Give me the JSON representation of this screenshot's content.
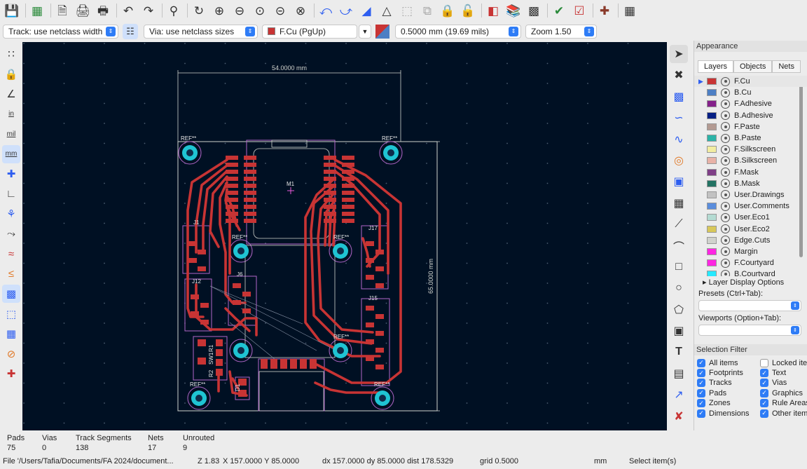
{
  "toolbar": {
    "buttons": [
      "save-icon",
      "board-setup-icon",
      "new-page-icon",
      "print-icon",
      "plot-icon",
      "undo-icon",
      "redo-icon",
      "find-icon",
      "refresh-icon",
      "zoom-in-icon",
      "zoom-out-icon",
      "zoom-fit-icon",
      "zoom-objects-icon",
      "zoom-selection-icon",
      "flip-icon",
      "rotate-ccw-icon",
      "rotate-cw-icon",
      "mirror-h-icon",
      "mirror-v-icon",
      "group-icon",
      "ungroup-icon",
      "lock-icon",
      "unlock-icon",
      "netlist-icon",
      "footprint-browser-icon",
      "footprint-editor-icon",
      "drc-icon",
      "scripting-icon",
      "bom-icon",
      "console-icon"
    ]
  },
  "aux_toolbar": {
    "track_width": "Track: use netclass width",
    "via_size": "Via: use netclass sizes",
    "active_layer": "F.Cu (PgUp)",
    "grid": "0.5000 mm (19.69 mils)",
    "zoom": "Zoom 1.50"
  },
  "left_toolbar": {
    "units": {
      "inch": "in",
      "mil": "mil",
      "mm": "mm"
    }
  },
  "canvas": {
    "width_dimension": "54.0000 mm",
    "height_dimension": "65.0000 mm",
    "labels": {
      "ref_tl": "REF**",
      "ref_tr": "REF**",
      "ref_ml": "REF**",
      "ref_mr": "REF**",
      "ref_bl": "REF**",
      "ref_br": "REF**",
      "ref_bm": "REF**",
      "ref_bml": "REF**",
      "m1": "M1",
      "j1": "J1",
      "j6": "J6",
      "j12": "J12",
      "j15": "J15",
      "j17": "J17",
      "r2": "R2",
      "sw1": "SW1",
      "r1": "R1",
      "d1": "D1"
    }
  },
  "appearance": {
    "title": "Appearance",
    "tabs": [
      "Layers",
      "Objects",
      "Nets"
    ],
    "layers": [
      {
        "name": "F.Cu",
        "color": "#c83434"
      },
      {
        "name": "B.Cu",
        "color": "#4d7fc4"
      },
      {
        "name": "F.Adhesive",
        "color": "#84218a"
      },
      {
        "name": "B.Adhesive",
        "color": "#051f84"
      },
      {
        "name": "F.Paste",
        "color": "#b39a92"
      },
      {
        "name": "B.Paste",
        "color": "#2bb3a7"
      },
      {
        "name": "F.Silkscreen",
        "color": "#f2eda1"
      },
      {
        "name": "B.Silkscreen",
        "color": "#e8b2a7"
      },
      {
        "name": "F.Mask",
        "color": "#7f3f87"
      },
      {
        "name": "B.Mask",
        "color": "#237363"
      },
      {
        "name": "User.Drawings",
        "color": "#c2c2c2"
      },
      {
        "name": "User.Comments",
        "color": "#5a8ddc"
      },
      {
        "name": "User.Eco1",
        "color": "#b4dbd2"
      },
      {
        "name": "User.Eco2",
        "color": "#d8c85a"
      },
      {
        "name": "Edge.Cuts",
        "color": "#d0d2cd"
      },
      {
        "name": "Margin",
        "color": "#ff26e2"
      },
      {
        "name": "F.Courtyard",
        "color": "#ff26e2"
      },
      {
        "name": "B.Courtyard",
        "color": "#26e9ff"
      }
    ],
    "layer_display_options": "Layer Display Options",
    "presets_label": "Presets (Ctrl+Tab):",
    "viewports_label": "Viewports (Option+Tab):"
  },
  "selection_filter": {
    "title": "Selection Filter",
    "items": [
      {
        "label": "All items",
        "checked": true
      },
      {
        "label": "Locked items",
        "checked": false
      },
      {
        "label": "Footprints",
        "checked": true
      },
      {
        "label": "Text",
        "checked": true
      },
      {
        "label": "Tracks",
        "checked": true
      },
      {
        "label": "Vias",
        "checked": true
      },
      {
        "label": "Pads",
        "checked": true
      },
      {
        "label": "Graphics",
        "checked": true
      },
      {
        "label": "Zones",
        "checked": true
      },
      {
        "label": "Rule Areas",
        "checked": true
      },
      {
        "label": "Dimensions",
        "checked": true
      },
      {
        "label": "Other items",
        "checked": true
      }
    ]
  },
  "stats": {
    "pads_label": "Pads",
    "pads_value": "75",
    "vias_label": "Vias",
    "vias_value": "0",
    "tracks_label": "Track Segments",
    "tracks_value": "138",
    "nets_label": "Nets",
    "nets_value": "17",
    "unrouted_label": "Unrouted",
    "unrouted_value": "9"
  },
  "status_bar": {
    "file": "File '/Users/Tafia/Documents/FA 2024/document...",
    "zoom": "Z 1.83",
    "coords": "X 157.0000  Y 85.0000",
    "delta": "dx 157.0000  dy 85.0000  dist 178.5329",
    "grid": "grid 0.5000",
    "units": "mm",
    "message": "Select item(s)"
  }
}
